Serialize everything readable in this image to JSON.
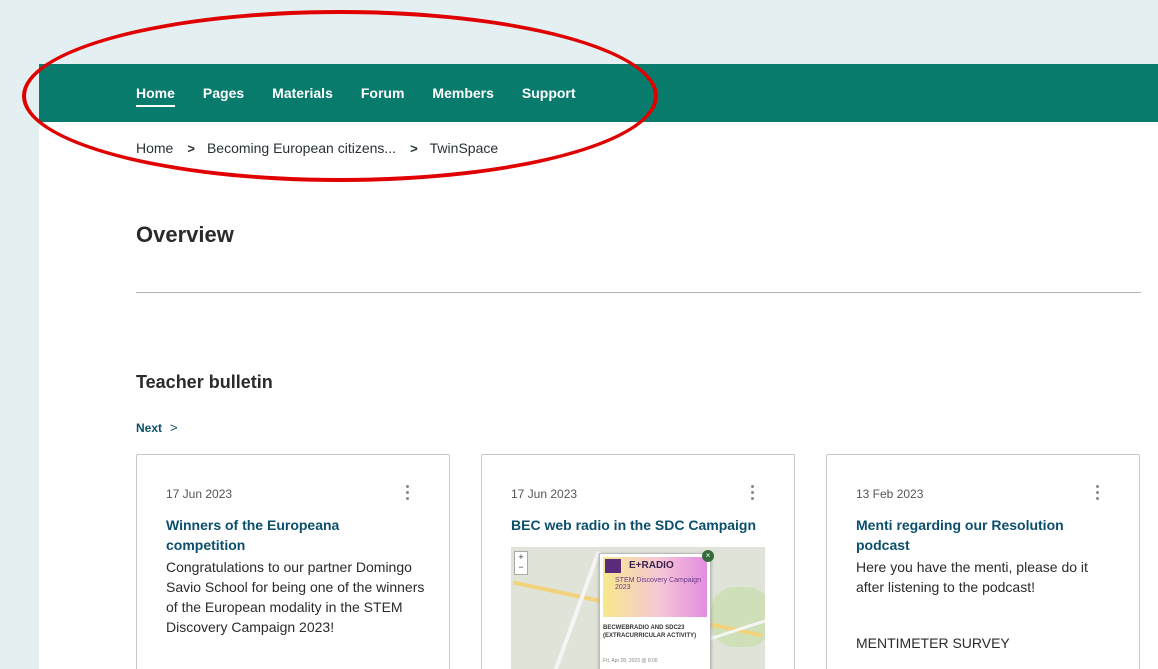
{
  "nav": {
    "items": [
      {
        "label": "Home",
        "active": true
      },
      {
        "label": "Pages"
      },
      {
        "label": "Materials"
      },
      {
        "label": "Forum"
      },
      {
        "label": "Members"
      },
      {
        "label": "Support"
      }
    ],
    "background_color": "#087b6c"
  },
  "breadcrumb": {
    "items": [
      "Home",
      "Becoming European citizens...",
      "TwinSpace"
    ],
    "separator_icon": "chevron-right-icon"
  },
  "page_title": "Overview",
  "section": {
    "title": "Teacher bulletin",
    "next_label": "Next",
    "next_icon": "chevron-right-icon"
  },
  "cards": [
    {
      "date": "17 Jun 2023",
      "title": "Winners of the Europeana competition",
      "body": "Congratulations to our partner Domingo Savio School for being one of the winners of the European modality in the STEM Discovery Campaign 2023!"
    },
    {
      "date": "17 Jun 2023",
      "title": "BEC web radio in the SDC Campaign",
      "map": {
        "zoom_in": "+",
        "zoom_out": "−",
        "popup_brand": "E+RADIO",
        "popup_sub": "STEM Discovery Campaign 2023",
        "popup_caption": "BECWEBRADIO AND SDC23 (EXTRACURRICULAR ACTIVITY)",
        "popup_date": "Fri, Apr 28, 2023 @ 8:00"
      }
    },
    {
      "date": "13 Feb 2023",
      "title": "Menti regarding our Resolution podcast",
      "body": "Here you have the menti, please do it after listening to the podcast!",
      "link_text": "MENTIMETER SURVEY"
    }
  ],
  "annotation_color": "#e00000"
}
